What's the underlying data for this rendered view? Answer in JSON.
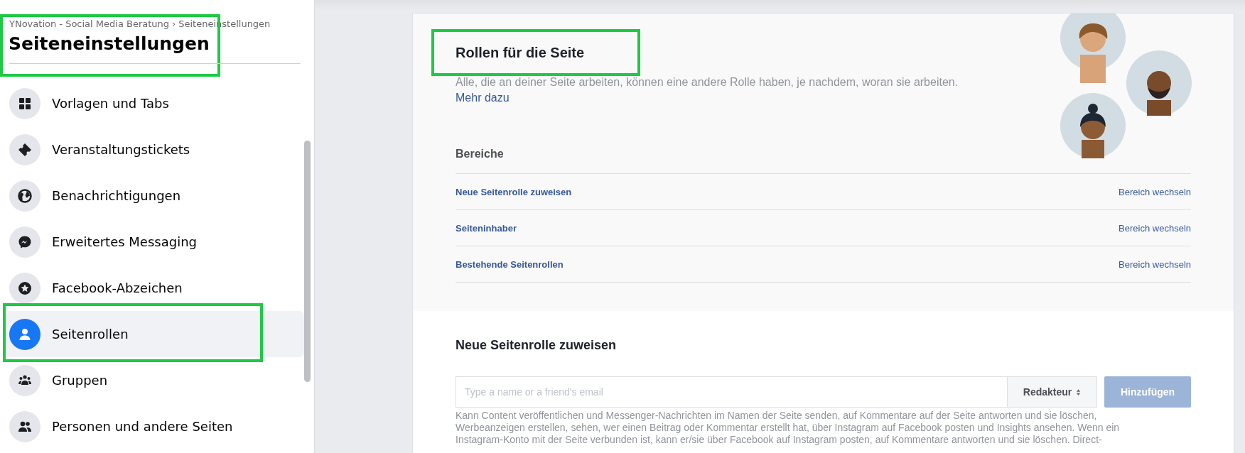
{
  "sidebar": {
    "breadcrumb": {
      "page": "YNovation - Social Media Beratung",
      "separator": "›",
      "current": "Seiteneinstellungen"
    },
    "title": {
      "text": "Seiteneinstellungen",
      "highlighted": true
    },
    "items": [
      {
        "label": "Vorlagen und Tabs",
        "selected": false,
        "highlighted": false
      },
      {
        "label": "Veranstaltungstickets",
        "selected": false,
        "highlighted": false
      },
      {
        "label": "Benachrichtigungen",
        "selected": false,
        "highlighted": false
      },
      {
        "label": "Erweitertes Messaging",
        "selected": false,
        "highlighted": false
      },
      {
        "label": "Facebook-Abzeichen",
        "selected": false,
        "highlighted": false
      },
      {
        "label": "Seitenrollen",
        "selected": true,
        "highlighted": true
      },
      {
        "label": "Gruppen",
        "selected": false,
        "highlighted": false
      },
      {
        "label": "Personen und andere Seiten",
        "selected": false,
        "highlighted": false
      }
    ]
  },
  "roles_section": {
    "title": {
      "text": "Rollen für die Seite",
      "highlighted": true
    },
    "description": "Alle, die an deiner Seite arbeiten, können eine andere Rolle haben, je nachdem, woran sie arbeiten.",
    "link": "Mehr dazu",
    "areas_heading": "Bereiche",
    "areas": [
      {
        "label": "Neue Seitenrolle zuweisen",
        "action": "Bereich wechseln"
      },
      {
        "label": "Seiteninhaber",
        "action": "Bereich wechseln"
      },
      {
        "label": "Bestehende Seitenrollen",
        "action": "Bereich wechseln"
      }
    ]
  },
  "assign_section": {
    "title": "Neue Seitenrolle zuweisen",
    "input": {
      "placeholder": "Type a name or a friend's email"
    },
    "role_select": {
      "value": "Redakteur"
    },
    "add_button": {
      "label": "Hinzufügen",
      "disabled": true
    },
    "description": "Kann Content veröffentlichen und Messenger-Nachrichten im Namen der Seite senden, auf Kommentare auf der Seite antworten und sie löschen, Werbeanzeigen erstellen, sehen, wer einen Beitrag oder Kommentar erstellt hat, über Instagram auf Facebook posten und Insights ansehen. Wenn ein Instagram-Konto mit der Seite verbunden ist, kann er/sie über Facebook auf Instagram posten, auf Kommentare antworten und sie löschen. Direct-"
  }
}
